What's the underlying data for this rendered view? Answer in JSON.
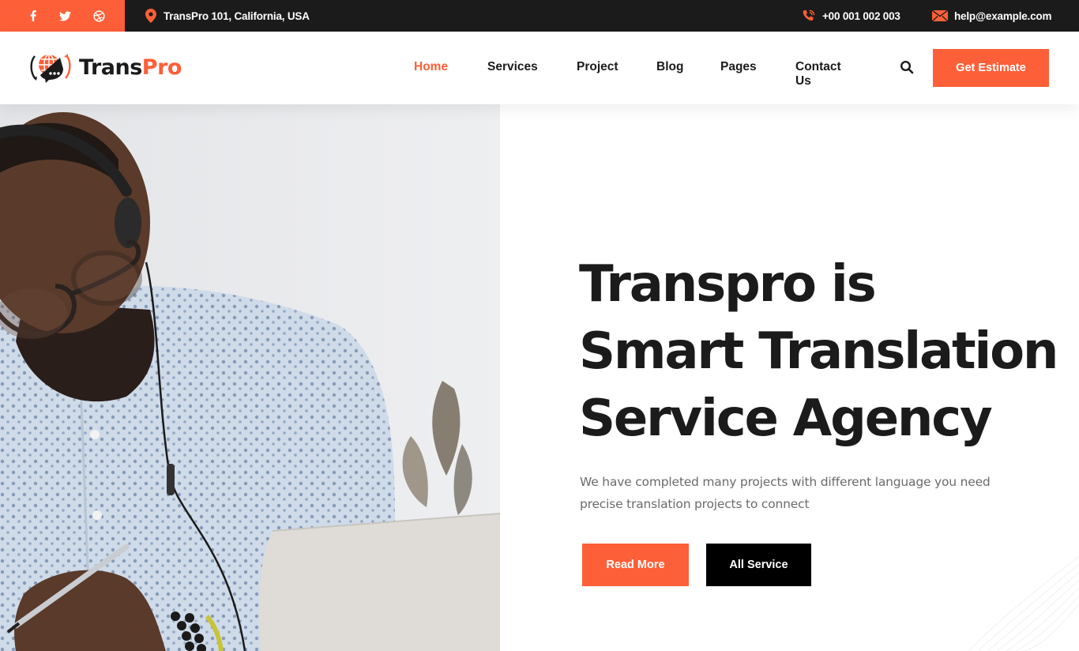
{
  "colors": {
    "accent": "#fd5f38",
    "dark": "#1b1b1b",
    "text_muted": "#6b6b6b",
    "topbar": "#1b1b1b"
  },
  "topbar": {
    "social": [
      {
        "name": "facebook-icon",
        "glyph": "f"
      },
      {
        "name": "twitter-icon",
        "glyph": "twitter"
      },
      {
        "name": "dribbble-icon",
        "glyph": "dribbble"
      }
    ],
    "address": "TransPro 101, California, USA",
    "phone": "+00 001 002 003",
    "email": "help@example.com"
  },
  "header": {
    "logo": {
      "part1": "Trans",
      "part2": "Pro"
    },
    "nav": [
      {
        "label": "Home",
        "active": true
      },
      {
        "label": "Services",
        "active": false
      },
      {
        "label": "Project",
        "active": false
      },
      {
        "label": "Blog",
        "active": false
      },
      {
        "label": "Pages",
        "active": false
      },
      {
        "label": "Contact Us",
        "active": false
      }
    ],
    "cta_label": "Get Estimate"
  },
  "hero": {
    "title_lines": [
      "Transpro is",
      "Smart Translation",
      "Service Agency"
    ],
    "description": "We have completed many projects with different language you need precise translation projects to connect",
    "primary_button": "Read More",
    "secondary_button": "All Service",
    "image_alt": "Man with headset and glasses working on laptop"
  }
}
